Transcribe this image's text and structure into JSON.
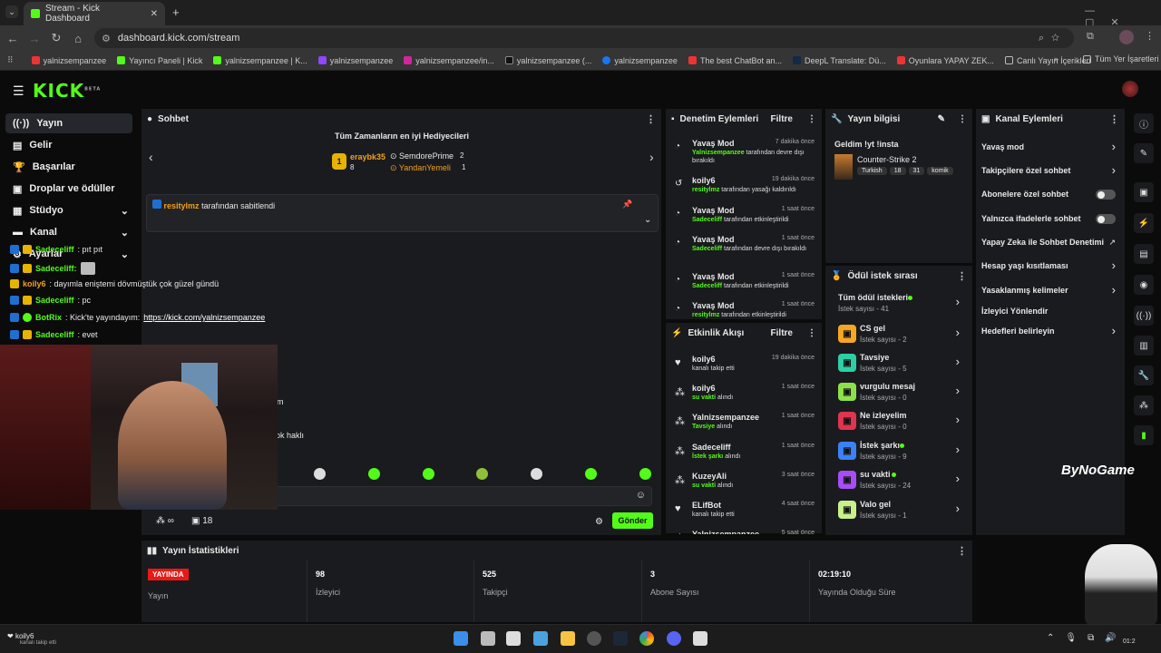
{
  "browser": {
    "tab_title": "Stream - Kick Dashboard",
    "url": "dashboard.kick.com/stream",
    "bookmarks": [
      "yalnizsempanzee",
      "Yayıncı Paneli | Kick",
      "yalnizsempanzee | K...",
      "yalnizsempanzee",
      "yalnizsempanzee/in...",
      "yalnizsempanzee (...",
      "yalnizsempanzee",
      "The best ChatBot an...",
      "DeepL Translate: Dü...",
      "Oyunlara YAPAY ZEK...",
      "Canlı Yayın İçerikleri"
    ],
    "all_bookmarks": "Tüm Yer İşaretleri"
  },
  "header": {
    "logo": "KICK",
    "logo_sup": "BETA"
  },
  "sidebar": {
    "items": [
      {
        "label": "Yayın"
      },
      {
        "label": "Gelir"
      },
      {
        "label": "Başarılar"
      },
      {
        "label": "Droplar ve ödüller"
      },
      {
        "label": "Stüdyo"
      },
      {
        "label": "Kanal"
      },
      {
        "label": "Ayarlar"
      }
    ]
  },
  "chat": {
    "title": "Sohbet",
    "gifters_title": "Tüm Zamanların en iyi Hediyecileri",
    "gifters": [
      {
        "rank": "1",
        "name": "eraybk35",
        "count": "8"
      },
      {
        "name": "SemdorePrime",
        "count": "2"
      },
      {
        "name": "YandanYemeli",
        "count": "1"
      }
    ],
    "pinned": {
      "by": "resitylmz",
      "text": "tarafından sabitlendi"
    },
    "messages": [
      {
        "user": "Sadeceliff",
        "text": ": pıt pıt"
      },
      {
        "user": "Sadeceliff:",
        "text": ""
      },
      {
        "user": "koily6",
        "text": ": dayımla eniştemi dövmüştük çok güzel gündü"
      },
      {
        "user": "Sadeceliff",
        "text": ": pc"
      },
      {
        "user": "BotRix",
        "text": ": Kick'te yayındayım: ",
        "link": "https://kick.com/yalnizsempanzee"
      },
      {
        "user": "Sadeceliff",
        "text": ": evet"
      }
    ],
    "partial1": "orum",
    "partial2": "n çok haklı",
    "viewers": "∞",
    "count": "18",
    "send": "Gönder"
  },
  "moderation": {
    "title": "Denetim Eylemleri",
    "filter": "Filtre",
    "items": [
      {
        "title": "Yavaş Mod",
        "time": "7 dakika önce",
        "actor": "Yalnizsempanzee",
        "desc": " tarafından devre dışı bırakıldı"
      },
      {
        "title": "koily6",
        "time": "19 dakika önce",
        "actor": "resitylmz",
        "desc": " tarafından yasağı kaldırıldı"
      },
      {
        "title": "Yavaş Mod",
        "time": "1 saat önce",
        "actor": "Sadeceliff",
        "desc": " tarafından etkinleştirildi"
      },
      {
        "title": "Yavaş Mod",
        "time": "1 saat önce",
        "actor": "Sadeceliff",
        "desc": " tarafından devre dışı bırakıldı"
      },
      {
        "title": "Yavaş Mod",
        "time": "1 saat önce",
        "actor": "Sadeceliff",
        "desc": " tarafından etkinleştirildi"
      },
      {
        "title": "Yavaş Mod",
        "time": "1 saat önce",
        "actor": "resitylmz",
        "desc": " tarafından etkinleştirildi"
      }
    ]
  },
  "activity": {
    "title": "Etkinlik Akışı",
    "filter": "Filtre",
    "items": [
      {
        "name": "koily6",
        "time": "19 dakika önce",
        "desc": "kanalı takip etti",
        "green": ""
      },
      {
        "name": "koily6",
        "time": "1 saat önce",
        "desc": " alındı",
        "green": "su vakti"
      },
      {
        "name": "Yalnizsempanzee",
        "time": "1 saat önce",
        "desc": " alındı",
        "green": "Tavsiye"
      },
      {
        "name": "Sadeceliff",
        "time": "1 saat önce",
        "desc": " alındı",
        "green": "İstek şarkı"
      },
      {
        "name": "KuzeyAli",
        "time": "3 saat önce",
        "desc": " alındı",
        "green": "su vakti"
      },
      {
        "name": "ELifBot",
        "time": "4 saat önce",
        "desc": "kanalı takip etti",
        "green": ""
      },
      {
        "name": "Yalnizsempanzee",
        "time": "5 saat önce",
        "desc": "",
        "green": ""
      }
    ]
  },
  "stream_info": {
    "title": "Yayın bilgisi",
    "stream_title": "Geldim !yt !insta",
    "category": "Counter-Strike 2",
    "tags": [
      "Turkish",
      "18",
      "31",
      "komik"
    ]
  },
  "rewards": {
    "title": "Ödül istek sırası",
    "items": [
      {
        "name": "Tüm ödül istekleri",
        "sub": "İstek sayısı - 41",
        "color": "",
        "dot": true
      },
      {
        "name": "CS gel",
        "sub": "İstek sayısı - 2",
        "color": "#f5a623",
        "dot": false
      },
      {
        "name": "Tavsiye",
        "sub": "İstek sayısı - 5",
        "color": "#2ecfa6",
        "dot": false
      },
      {
        "name": "vurgulu mesaj",
        "sub": "İstek sayısı - 0",
        "color": "#8ee04a",
        "dot": false
      },
      {
        "name": "Ne izleyelim",
        "sub": "İstek sayısı - 0",
        "color": "#e0344f",
        "dot": false
      },
      {
        "name": "İstek şarkı",
        "sub": "İstek sayısı - 9",
        "color": "#3b82f6",
        "dot": true
      },
      {
        "name": "su vakti",
        "sub": "İstek sayısı - 24",
        "color": "#a64df5",
        "dot": true
      },
      {
        "name": "Valo gel",
        "sub": "İstek sayısı - 1",
        "color": "#c8f08a",
        "dot": false
      }
    ]
  },
  "channel_actions": {
    "title": "Kanal Eylemleri",
    "items": [
      {
        "label": "Yavaş mod",
        "control": "chevron"
      },
      {
        "label": "Takipçilere özel sohbet",
        "control": "chevron"
      },
      {
        "label": "Abonelere özel sohbet",
        "control": "toggle"
      },
      {
        "label": "Yalnızca ifadelerle sohbet",
        "control": "toggle"
      },
      {
        "label": "Yapay Zeka ile Sohbet Denetimi",
        "control": "external"
      },
      {
        "label": "Hesap yaşı kısıtlaması",
        "control": "chevron"
      },
      {
        "label": "Yasaklanmış kelimeler",
        "control": "chevron"
      },
      {
        "label": "İzleyici Yönlendir",
        "control": "none"
      },
      {
        "label": "Hedefleri belirleyin",
        "control": "chevron"
      }
    ]
  },
  "stats": {
    "title": "Yayın İstatistikleri",
    "live_badge": "YAYINDA",
    "live_label": "Yayın",
    "items": [
      {
        "value": "98",
        "label": "İzleyici"
      },
      {
        "value": "525",
        "label": "Takipçi"
      },
      {
        "value": "3",
        "label": "Abone Sayısı"
      },
      {
        "value": "02:19:10",
        "label": "Yayında Olduğu Süre"
      }
    ]
  },
  "overlay": {
    "watermark": "ByNoGame",
    "notif_user": "koily6",
    "notif_text": "kanalı takip etti",
    "clock": "01:2"
  }
}
